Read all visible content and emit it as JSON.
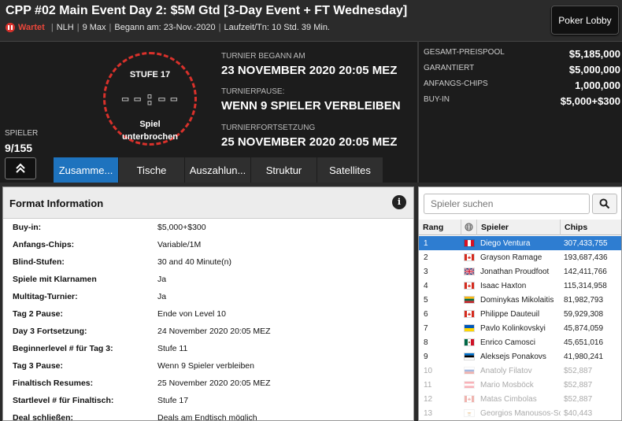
{
  "header": {
    "title": "CPP #02 Main Event Day 2: $5M Gtd [3-Day Event + FT Wednesday]",
    "status": "Wartet",
    "game": "NLH",
    "max": "9 Max",
    "started": "Begann am: 23-Nov.-2020",
    "runtime": "Laufzeit/Tn: 10 Std. 39 Min.",
    "lobby_button": "Poker Lobby"
  },
  "clock": {
    "level": "STUFE 17",
    "time": "--:--",
    "message_line1": "Spiel",
    "message_line2": "unterbrochen"
  },
  "players": {
    "label": "SPIELER",
    "count": "9/155"
  },
  "schedule": {
    "started_label": "TURNIER BEGANN AM",
    "started_value": "23 NOVEMBER 2020  20:05 MEZ",
    "break_label": "TURNIERPAUSE:",
    "break_value": "WENN 9 SPIELER VERBLEIBEN",
    "resume_label": "TURNIERFORTSETZUNG",
    "resume_value": "25 NOVEMBER 2020  20:05 MEZ"
  },
  "prize": {
    "pool_label": "GESAMT-PREISPOOL",
    "pool_value": "$5,185,000",
    "guaranteed_label": "GARANTIERT",
    "guaranteed_value": "$5,000,000",
    "chips_label": "ANFANGS-CHIPS",
    "chips_value": "1,000,000",
    "buyin_label": "BUY-IN",
    "buyin_value": "$5,000+$300"
  },
  "tabs": [
    "Zusamme...",
    "Tische",
    "Auszahlun...",
    "Struktur",
    "Satellites"
  ],
  "format": {
    "title": "Format Information",
    "info_icon": "i",
    "rows": [
      {
        "key": "Buy-in:",
        "value": "$5,000+$300"
      },
      {
        "key": "Anfangs-Chips:",
        "value": "Variable/1M"
      },
      {
        "key": "Blind-Stufen:",
        "value": "30 and 40 Minute(n)"
      },
      {
        "key": "Spiele mit Klarnamen",
        "value": "Ja"
      },
      {
        "key": "Multitag-Turnier:",
        "value": "Ja"
      },
      {
        "key": "Tag 2 Pause:",
        "value": "Ende von Level 10"
      },
      {
        "key": "Day 3 Fortsetzung:",
        "value": "24 November 2020  20:05 MEZ"
      },
      {
        "key": "Beginnerlevel # für Tag 3:",
        "value": "Stufe 11"
      },
      {
        "key": "Tag 3 Pause:",
        "value": "Wenn 9 Spieler verbleiben"
      },
      {
        "key": "Finaltisch Resumes:",
        "value": "25 November 2020  20:05 MEZ"
      },
      {
        "key": "Startlevel # für Finaltisch:",
        "value": "Stufe 17"
      },
      {
        "key": "Deal schließen:",
        "value": "Deals am Endtisch möglich"
      }
    ]
  },
  "player_list": {
    "search_placeholder": "Spieler suchen",
    "headers": {
      "rank": "Rang",
      "player": "Spieler",
      "chips": "Chips"
    },
    "rows": [
      {
        "rank": "1",
        "flag": "peru",
        "name": "Diego Ventura",
        "chips": "307,433,755",
        "selected": true,
        "faded": false
      },
      {
        "rank": "2",
        "flag": "canada",
        "name": "Grayson Ramage",
        "chips": "193,687,436",
        "selected": false,
        "faded": false
      },
      {
        "rank": "3",
        "flag": "uk",
        "name": "Jonathan Proudfoot",
        "chips": "142,411,766",
        "selected": false,
        "faded": false
      },
      {
        "rank": "4",
        "flag": "canada",
        "name": "Isaac Haxton",
        "chips": "115,314,958",
        "selected": false,
        "faded": false
      },
      {
        "rank": "5",
        "flag": "lithuania",
        "name": "Dominykas Mikolaitis",
        "chips": "81,982,793",
        "selected": false,
        "faded": false
      },
      {
        "rank": "6",
        "flag": "canada",
        "name": "Philippe Dauteuil",
        "chips": "59,929,308",
        "selected": false,
        "faded": false
      },
      {
        "rank": "7",
        "flag": "ukraine",
        "name": "Pavlo Kolinkovskyi",
        "chips": "45,874,059",
        "selected": false,
        "faded": false
      },
      {
        "rank": "8",
        "flag": "mexico",
        "name": "Enrico Camosci",
        "chips": "45,651,016",
        "selected": false,
        "faded": false
      },
      {
        "rank": "9",
        "flag": "estonia",
        "name": "Aleksejs Ponakovs",
        "chips": "41,980,241",
        "selected": false,
        "faded": false
      },
      {
        "rank": "10",
        "flag": "russia",
        "name": "Anatoly Filatov",
        "chips": "$52,887",
        "selected": false,
        "faded": true
      },
      {
        "rank": "11",
        "flag": "austria",
        "name": "Mario Mosböck",
        "chips": "$52,887",
        "selected": false,
        "faded": true
      },
      {
        "rank": "12",
        "flag": "canada",
        "name": "Matas Cimbolas",
        "chips": "$52,887",
        "selected": false,
        "faded": true
      },
      {
        "rank": "13",
        "flag": "cyprus",
        "name": "Georgios Manousos-Sot...",
        "chips": "$40,443",
        "selected": false,
        "faded": true
      }
    ]
  },
  "colors": {
    "accent": "#1e73be",
    "status_red": "#d9312b",
    "selected_row": "#2e7dd1"
  }
}
